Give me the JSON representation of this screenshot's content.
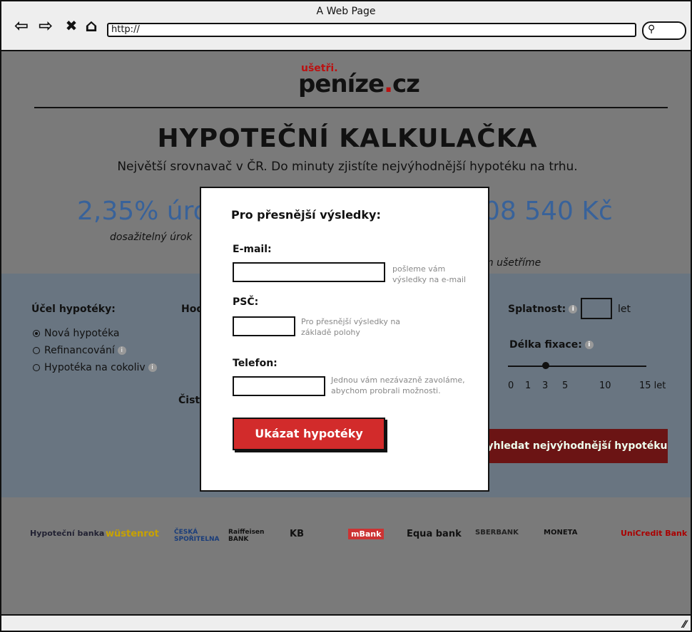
{
  "browser": {
    "title": "A Web Page",
    "url": "http://",
    "icons": [
      "back-arrow-icon",
      "forward-arrow-icon",
      "close-icon",
      "home-icon",
      "search-icon"
    ]
  },
  "header": {
    "logo_small": "ušetři.",
    "logo_main": "peníze",
    "logo_tld": ".cz"
  },
  "hero": {
    "title": "HYPOTEČNÍ KALKULAČKA",
    "subtitle": "Největší srovnavač v ČR. Do minuty zjistíte nejvýhodnější hypotéku na trhu.",
    "stat_left_value": "2,35% úro",
    "stat_left_caption": "dosažitelný úrok",
    "stat_right_value": "08 540 Kč",
    "stat_right_caption": "m ušetříme"
  },
  "calculator": {
    "purpose_label": "Účel hypotéky:",
    "purpose_options": [
      "Nová hypotéka",
      "Refinancování",
      "Hypotéka na cokoliv"
    ],
    "purpose_selected": "Nová hypotéka",
    "value_label_partial": "Hod",
    "net_label_partial": "Čist",
    "repayment_label": "Splatnost:",
    "repayment_unit": "let",
    "fixation_label": "Délka fixace:",
    "fixation_ticks": [
      "0",
      "1",
      "3",
      "5",
      "10",
      "15 let"
    ],
    "fixation_value": 3,
    "search_button": "yhledat nejvýhodnější hypotéku"
  },
  "banks": [
    "Hypoteční banka",
    "wüstenrot",
    "ČESKÁ SPOŘITELNA",
    "Raiffeisen BANK",
    "KB",
    "mBank",
    "Equa bank",
    "SBERBANK",
    "MONETA",
    "UniCredit Bank"
  ],
  "modal": {
    "title": "Pro přesnější výsledky:",
    "email_label": "E-mail:",
    "email_hint": "pošleme vám výsledky na e-mail",
    "psc_label": "PSČ:",
    "psc_hint": "Pro přesnější výsledky na základě polohy",
    "phone_label": "Telefon:",
    "phone_hint": "Jednou vám nezávazně zavoláme, abychom probrali možnosti.",
    "submit": "Ukázat hypotéky"
  }
}
